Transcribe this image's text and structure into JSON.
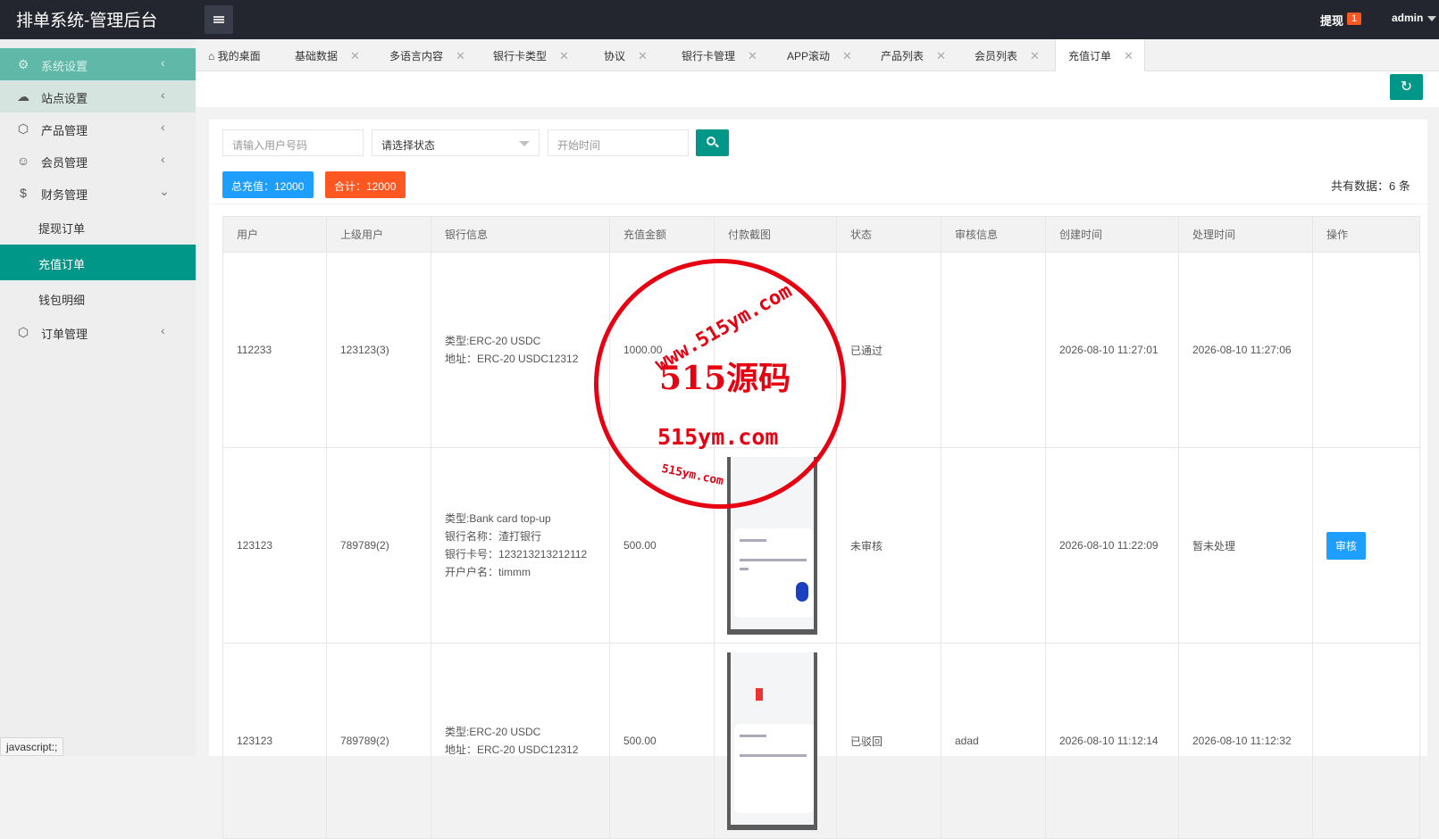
{
  "app": {
    "title": "排单系统-管理后台"
  },
  "header": {
    "withdraw_label": "提现",
    "withdraw_badge": "1",
    "user": "admin"
  },
  "sidebar": {
    "items": [
      {
        "label": "系统设置",
        "icon": "gear-icon"
      },
      {
        "label": "站点设置",
        "icon": "cloud-icon"
      },
      {
        "label": "产品管理",
        "icon": "cube-icon"
      },
      {
        "label": "会员管理",
        "icon": "user-icon"
      },
      {
        "label": "财务管理",
        "icon": "dollar-icon"
      }
    ],
    "finance_sub": [
      "提现订单",
      "充值订单",
      "钱包明细"
    ],
    "order": {
      "label": "订单管理",
      "icon": "cube-icon"
    }
  },
  "tabs": [
    {
      "label": "我的桌面"
    },
    {
      "label": "基础数据"
    },
    {
      "label": "多语言内容"
    },
    {
      "label": "银行卡类型"
    },
    {
      "label": "协议"
    },
    {
      "label": "银行卡管理"
    },
    {
      "label": "APP滚动"
    },
    {
      "label": "产品列表"
    },
    {
      "label": "会员列表"
    },
    {
      "label": "充值订单"
    }
  ],
  "filters": {
    "user_placeholder": "请输入用户号码",
    "status_value": "请选择状态",
    "start_placeholder": "开始时间"
  },
  "summary": {
    "total_recharge": "总充值：12000",
    "sum": "合计：12000",
    "count": "共有数据：6 条"
  },
  "table": {
    "headers": [
      "用户",
      "上级用户",
      "银行信息",
      "充值金额",
      "付款截图",
      "状态",
      "审核信息",
      "创建时间",
      "处理时间",
      "操作"
    ],
    "rows": [
      {
        "user": "112233",
        "parent": "123123(3)",
        "bank": [
          "类型:ERC-20 USDC",
          "地址：ERC-20 USDC12312"
        ],
        "amount": "1000.00",
        "status": "已通过",
        "review": "",
        "created": "2026-08-10 11:27:01",
        "processed": "2026-08-10 11:27:06",
        "action": ""
      },
      {
        "user": "123123",
        "parent": "789789(2)",
        "bank": [
          "类型:Bank card top-up",
          "银行名称：渣打银行",
          "银行卡号：123213213212112",
          "开户户名：timmm"
        ],
        "amount": "500.00",
        "status": "未审核",
        "review": "",
        "created": "2026-08-10 11:22:09",
        "processed": "暂未处理",
        "action": "审核"
      },
      {
        "user": "123123",
        "parent": "789789(2)",
        "bank": [
          "类型:ERC-20 USDC",
          "地址：ERC-20 USDC12312"
        ],
        "amount": "500.00",
        "status": "已驳回",
        "review": "adad",
        "created": "2026-08-10 11:12:14",
        "processed": "2026-08-10 11:12:32",
        "action": ""
      }
    ]
  },
  "watermark": {
    "main": "515源码",
    "domain": "515ym.com",
    "arc_top": "www.515ym.com",
    "arc_bottom": "515ym.com"
  },
  "statusbar": "javascript:;",
  "colors": {
    "primary": "#009688",
    "blue": "#1e9fff",
    "orange": "#ff5722",
    "header": "#23262e",
    "stamp": "#e60012"
  }
}
